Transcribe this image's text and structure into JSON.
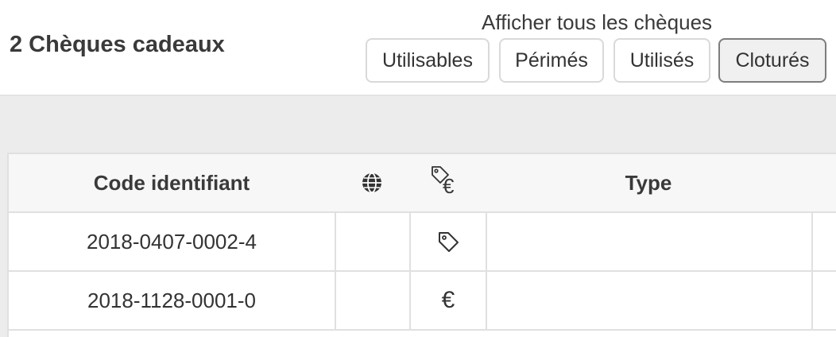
{
  "header": {
    "title": "2 Chèques cadeaux",
    "filter_caption": "Afficher tous les chèques",
    "filters": [
      {
        "label": "Utilisables",
        "active": false
      },
      {
        "label": "Périmés",
        "active": false
      },
      {
        "label": "Utilisés",
        "active": false
      },
      {
        "label": "Cloturés",
        "active": true
      }
    ]
  },
  "table": {
    "columns": {
      "code": "Code identifiant",
      "web": "globe-icon",
      "kind": "tag-euro-icon",
      "type": "Type"
    },
    "rows": [
      {
        "code": "2018-0407-0002-4",
        "kind_icon": "tag-icon",
        "type": ""
      },
      {
        "code": "2018-1128-0001-0",
        "kind_icon": "euro-icon",
        "kind_symbol": "€",
        "type": ""
      }
    ],
    "header_euro_symbol": "€"
  },
  "colors": {
    "active_button_bg": "#f0f0f0",
    "active_button_border": "#7d7d7d",
    "band_bg": "#ececec",
    "header_row_bg": "#f7f7f7"
  }
}
